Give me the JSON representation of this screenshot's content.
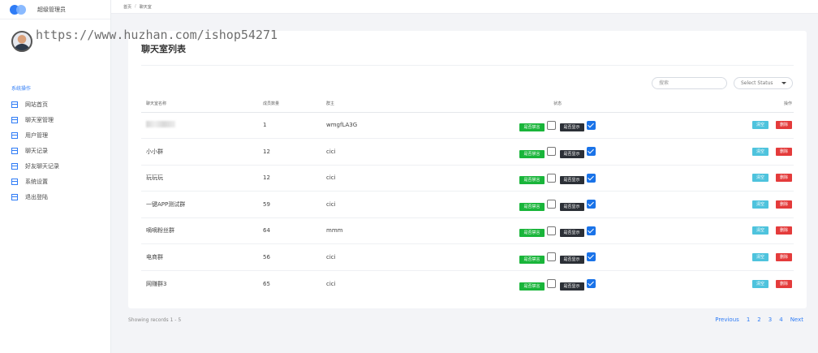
{
  "sidebar": {
    "brand": "超级管理员",
    "section_label": "系统操作",
    "items": [
      {
        "label": "网站首页"
      },
      {
        "label": "聊天室管理"
      },
      {
        "label": "用户管理"
      },
      {
        "label": "聊天记录"
      },
      {
        "label": "好友聊天记录"
      },
      {
        "label": "系统设置"
      },
      {
        "label": "退出登陆"
      }
    ]
  },
  "breadcrumb": {
    "home": "首页",
    "separator": "/",
    "current": "聊天室"
  },
  "watermark": "https://www.huzhan.com/ishop54271",
  "main": {
    "title": "聊天室列表",
    "search_placeholder": "搜索",
    "status_select": "Select Status"
  },
  "table": {
    "headers": {
      "name": "聊天室名称",
      "members": "成员数量",
      "owner": "群主",
      "status": "状态",
      "actions": "操作"
    },
    "rows": [
      {
        "name": "",
        "members": "1",
        "owner": "wmgfLA3G"
      },
      {
        "name": "小小群",
        "members": "12",
        "owner": "cici"
      },
      {
        "name": "玩玩玩",
        "members": "12",
        "owner": "cici"
      },
      {
        "name": "一键APP测试群",
        "members": "59",
        "owner": "cici"
      },
      {
        "name": "嘀嘀粉丝群",
        "members": "64",
        "owner": "mmm"
      },
      {
        "name": "电商群",
        "members": "56",
        "owner": "cici"
      },
      {
        "name": "网赚群3",
        "members": "65",
        "owner": "cici"
      }
    ],
    "mute_label": "是否禁言",
    "show_label": "是否显示",
    "clear_label": "清空",
    "delete_label": "删除"
  },
  "footer": {
    "records": "Showing records 1 - 5",
    "pagination": {
      "previous": "Previous",
      "pages": [
        "1",
        "2",
        "3",
        "4"
      ],
      "next": "Next"
    }
  },
  "colors": {
    "accent": "#2f7cf6",
    "mute": "#19b53a",
    "show": "#2b2f36",
    "clear": "#4ec3dd",
    "delete": "#e43b3b"
  }
}
